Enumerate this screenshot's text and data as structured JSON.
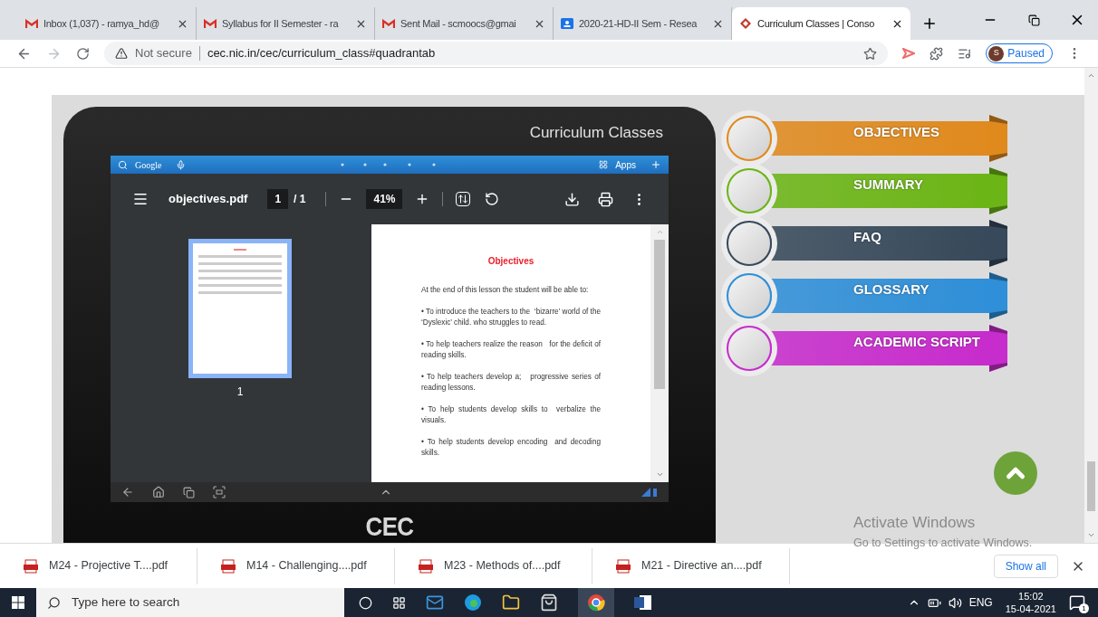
{
  "browser": {
    "tabs": [
      {
        "title": "Inbox (1,037) - ramya_hd@",
        "kind": "gmail",
        "selected": false
      },
      {
        "title": "Syllabus for II Semester - ra",
        "kind": "gmail",
        "selected": false
      },
      {
        "title": "Sent Mail - scmoocs@gmai",
        "kind": "gmail",
        "selected": false
      },
      {
        "title": "2020-21-HD-II Sem - Resea",
        "kind": "classroom",
        "selected": false
      },
      {
        "title": "Curriculum Classes | Conso",
        "kind": "site",
        "selected": true
      }
    ],
    "security": "Not secure",
    "url": "cec.nic.in/cec/curriculum_class#quadrantab",
    "profile_initial": "S",
    "profile_status": "Paused"
  },
  "tablet": {
    "title": "Curriculum Classes",
    "search_label": "Google",
    "apps_label": "Apps",
    "brand": "CEC",
    "pdf": {
      "filename": "objectives.pdf",
      "page": "1",
      "page_total": "/ 1",
      "zoom": "41%",
      "thumbnail_label": "1",
      "heading": "Objectives",
      "paragraphs": [
        "At the end of this lesson the student will be able to:",
        "• To introduce the teachers to the  ‘bizarre’ world of the ‘Dyslexic’ child. who struggles to read.",
        "• To help teachers realize the reason   for the deficit of reading skills.",
        "• To help teachers develop a;   progressive series of reading lessons.",
        "• To help students develop skills to  verbalize the visuals.",
        "• To help students develop encoding  and decoding skills."
      ]
    }
  },
  "menu": [
    {
      "label": "OBJECTIVES",
      "color": "#e08a1e"
    },
    {
      "label": "SUMMARY",
      "color": "#6cb516"
    },
    {
      "label": "FAQ",
      "color": "#37495a"
    },
    {
      "label": "GLOSSARY",
      "color": "#2f8fd8"
    },
    {
      "label": "ACADEMIC SCRIPT",
      "color": "#c72ccc"
    }
  ],
  "activation": {
    "title": "Activate Windows",
    "subtitle": "Go to Settings to activate Windows."
  },
  "downloads": {
    "items": [
      "M24 - Projective T....pdf",
      "M14 - Challenging....pdf",
      "M23 - Methods of....pdf",
      "M21 - Directive an....pdf"
    ],
    "show_all": "Show all"
  },
  "taskbar": {
    "search_placeholder": "Type here to search",
    "language": "ENG",
    "time": "15:02",
    "date": "15-04-2021",
    "notifications": "1"
  }
}
